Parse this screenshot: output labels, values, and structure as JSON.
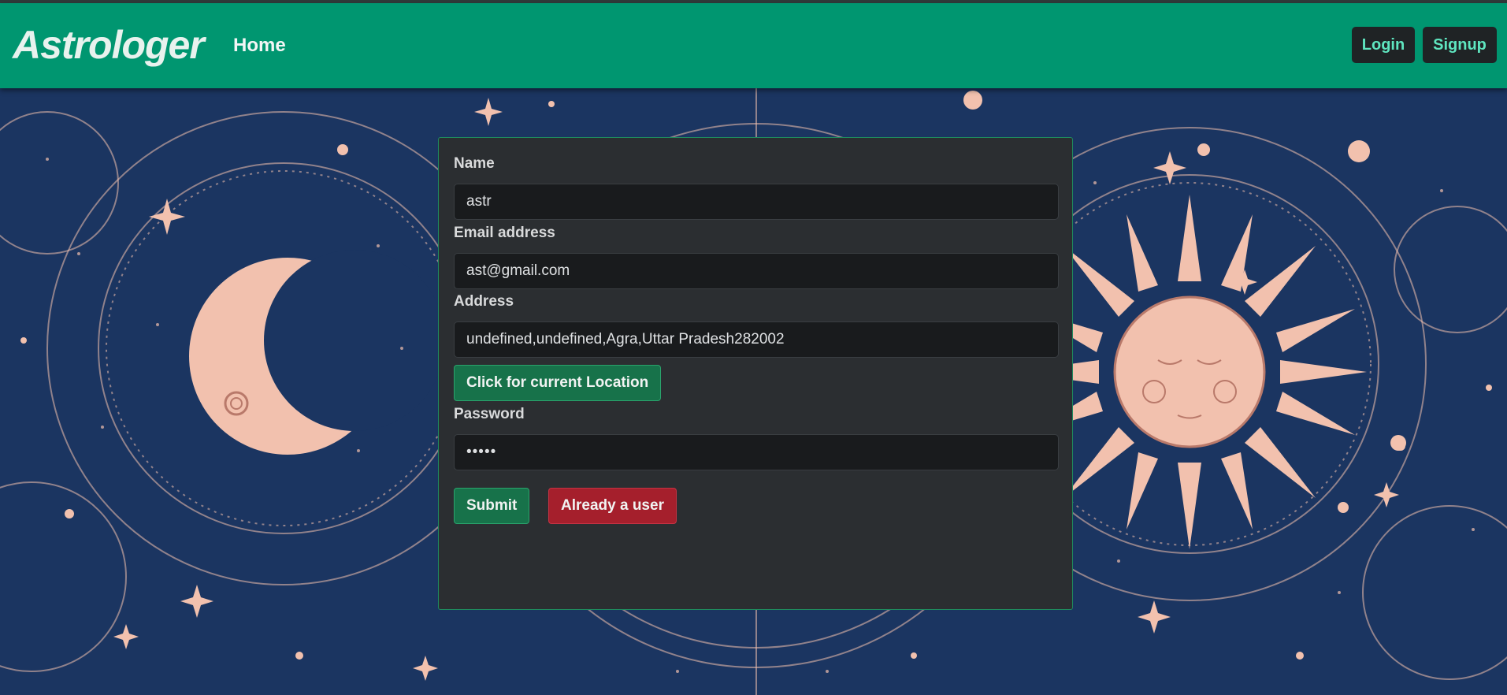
{
  "navbar": {
    "brand": "Astrologer",
    "home_label": "Home",
    "login_label": "Login",
    "signup_label": "Signup"
  },
  "form": {
    "name_label": "Name",
    "name_value": "astr",
    "email_label": "Email address",
    "email_value": "ast@gmail.com",
    "address_label": "Address",
    "address_value": "undefined,undefined,Agra,Uttar Pradesh282002",
    "location_button": "Click for current Location",
    "password_label": "Password",
    "password_value": "•••••",
    "submit_button": "Submit",
    "already_user_button": "Already a user"
  },
  "colors": {
    "navbar": "#009670",
    "background": "#1b3561",
    "illustration": "#f2c1ae",
    "card": "#2b2e31",
    "success": "#17724a",
    "danger": "#a51f2c"
  },
  "icons": [
    "moon-face-illustration",
    "sun-face-illustration",
    "star-icon"
  ]
}
